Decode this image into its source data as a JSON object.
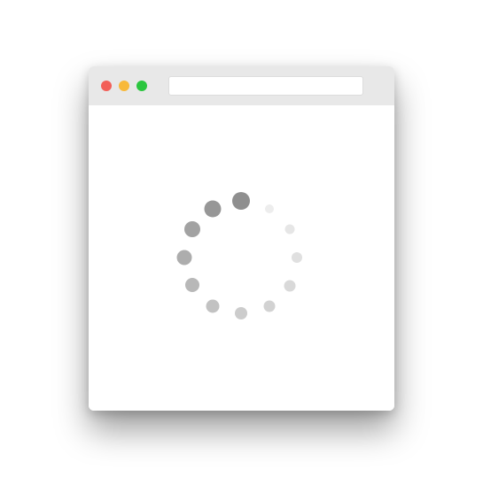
{
  "window": {
    "address_bar": {
      "value": "",
      "placeholder": ""
    },
    "traffic_lights": {
      "close_color": "#f25f58",
      "minimize_color": "#f8b93a",
      "zoom_color": "#2bc63f"
    }
  },
  "content": {
    "spinner": {
      "icon": "loading-spinner-icon",
      "dot_count": 12,
      "color": "#999999"
    }
  }
}
